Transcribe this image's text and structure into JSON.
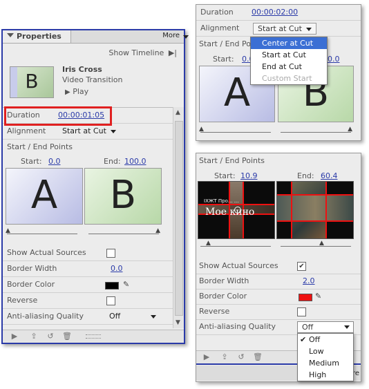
{
  "main": {
    "tab_label": "Properties",
    "more_label": "More",
    "show_timeline": "Show Timeline",
    "clip_letter": "B",
    "clip_title": "Iris Cross",
    "clip_subtitle": "Video Transition",
    "play_label": "Play",
    "duration_label": "Duration",
    "duration_value": "00:00:01:05",
    "alignment_label": "Alignment",
    "alignment_value": "Start at Cut",
    "start_end_label": "Start / End Points",
    "start_label": "Start:",
    "start_value": "0.0",
    "end_label": "End:",
    "end_value": "100.0",
    "letter_a": "A",
    "letter_b": "B",
    "show_sources_label": "Show Actual Sources",
    "show_sources_checked": false,
    "border_width_label": "Border Width",
    "border_width_value": "0.0",
    "border_color_label": "Border Color",
    "border_color": "#000000",
    "reverse_label": "Reverse",
    "aa_label": "Anti-aliasing Quality",
    "aa_value": "Off"
  },
  "top_right": {
    "duration_label": "Duration",
    "duration_value": "00:00:02:00",
    "alignment_label": "Alignment",
    "alignment_value": "Start at Cut",
    "start_end_label": "Start / End Points",
    "start_label": "Start:",
    "start_value": "0.0",
    "end_value": "0.0",
    "letter_a": "A",
    "letter_b": "B",
    "menu": [
      "Center at Cut",
      "Start at Cut",
      "End at Cut",
      "Custom Start"
    ]
  },
  "bottom_right": {
    "start_end_label": "Start / End Points",
    "start_label": "Start:",
    "start_value": "10.9",
    "end_label": "End:",
    "end_value": "60.4",
    "video_text_big": "Мое кино",
    "video_text_small": "IXЖТ Про... ...",
    "show_sources_label": "Show Actual Sources",
    "show_sources_checked": true,
    "border_width_label": "Border Width",
    "border_width_value": "2.0",
    "border_color_label": "Border Color",
    "border_color": "#ee1111",
    "reverse_label": "Reverse",
    "aa_label": "Anti-aliasing Quality",
    "aa_value": "Off",
    "aa_options": [
      "Off",
      "Low",
      "Medium",
      "High"
    ],
    "more_partial": "ore"
  },
  "colors": {
    "accent": "#2a3aa8",
    "highlight": "#3b6fd4",
    "red_box": "#e02020"
  }
}
